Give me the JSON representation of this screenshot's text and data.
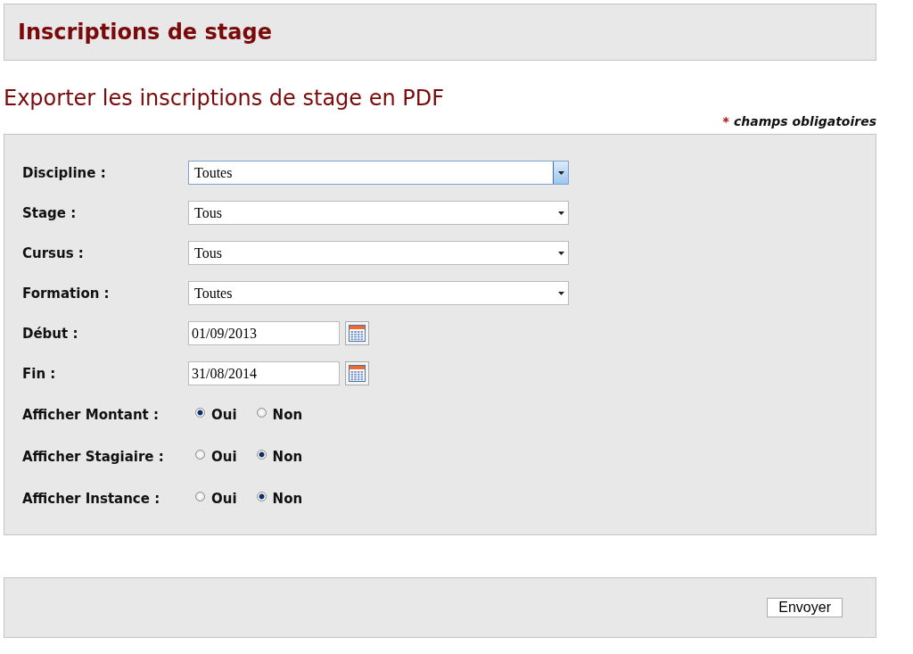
{
  "header": {
    "title": "Inscriptions de stage"
  },
  "page_title": "Exporter les inscriptions de stage en PDF",
  "required_note": {
    "marker": "*",
    "text": "champs obligatoires"
  },
  "fields": [
    {
      "kind": "select",
      "label": "Discipline :",
      "value": "Toutes",
      "focused": true
    },
    {
      "kind": "select",
      "label": "Stage :",
      "value": "Tous",
      "focused": false
    },
    {
      "kind": "select",
      "label": "Cursus :",
      "value": "Tous",
      "focused": false
    },
    {
      "kind": "select",
      "label": "Formation :",
      "value": "Toutes",
      "focused": false
    },
    {
      "kind": "date",
      "label": "Début :",
      "value": "01/09/2013"
    },
    {
      "kind": "date",
      "label": "Fin :",
      "value": "31/08/2014"
    },
    {
      "kind": "radio",
      "label": "Afficher Montant :",
      "options": [
        {
          "label": "Oui",
          "selected": true
        },
        {
          "label": "Non",
          "selected": false
        }
      ]
    },
    {
      "kind": "radio",
      "label": "Afficher Stagiaire :",
      "options": [
        {
          "label": "Oui",
          "selected": false
        },
        {
          "label": "Non",
          "selected": true
        }
      ]
    },
    {
      "kind": "radio",
      "label": "Afficher Instance :",
      "options": [
        {
          "label": "Oui",
          "selected": false
        },
        {
          "label": "Non",
          "selected": true
        }
      ]
    }
  ],
  "submit": "Envoyer"
}
